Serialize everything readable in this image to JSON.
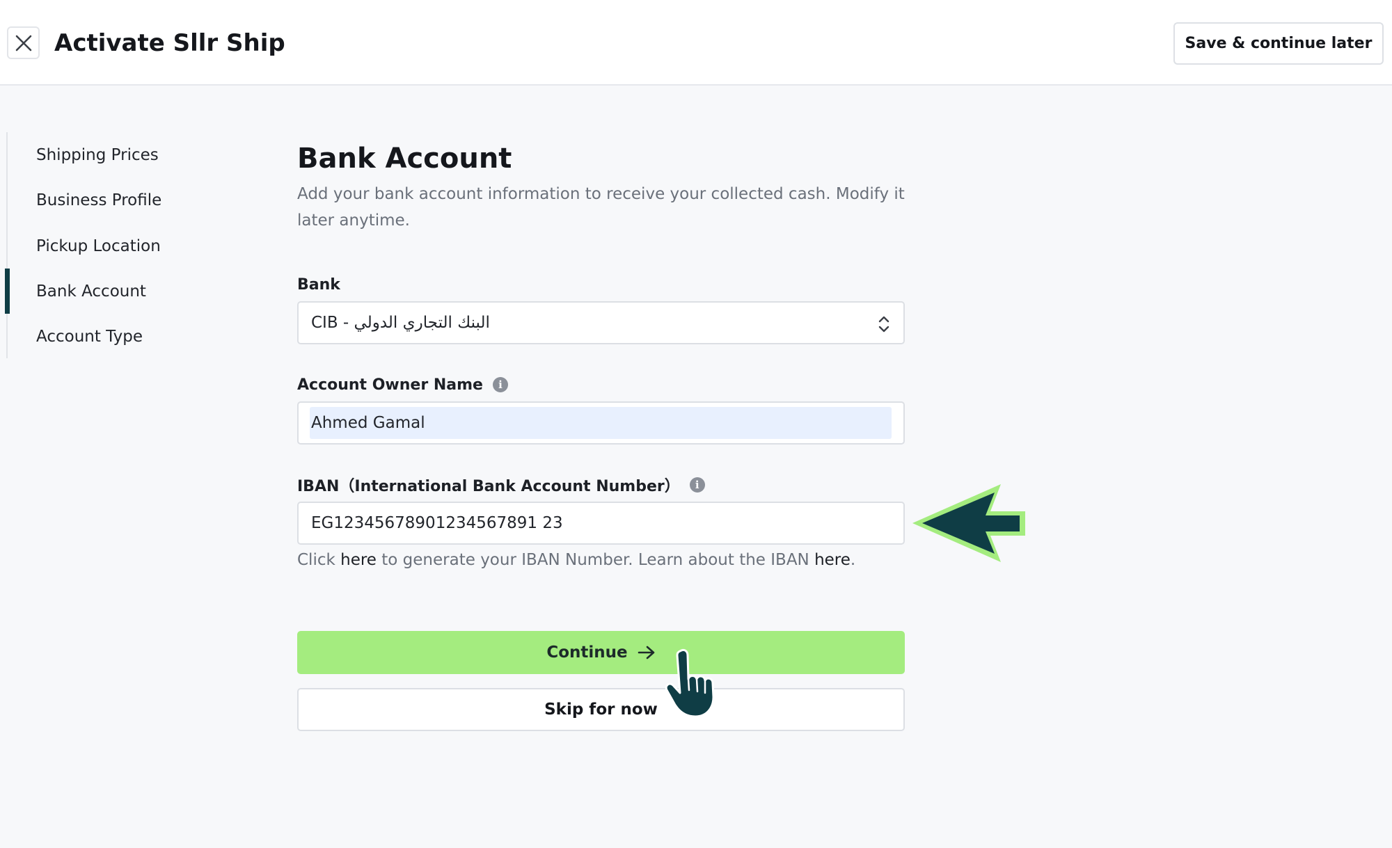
{
  "header": {
    "title": "Activate Sllr Ship",
    "save_later_label": "Save & continue later"
  },
  "sidebar": {
    "items": [
      {
        "label": "Shipping Prices",
        "active": false
      },
      {
        "label": "Business Profile",
        "active": false
      },
      {
        "label": "Pickup Location",
        "active": false
      },
      {
        "label": "Bank Account",
        "active": true
      },
      {
        "label": "Account Type",
        "active": false
      }
    ]
  },
  "form": {
    "title": "Bank Account",
    "description": "Add your bank account information to receive your collected cash. Modify it later anytime.",
    "bank": {
      "label": "Bank",
      "value": "CIB - البنك التجاري الدولي"
    },
    "owner": {
      "label": "Account Owner Name",
      "value": "Ahmed Gamal"
    },
    "iban": {
      "label": "IBAN（International Bank Account Number）",
      "value": "EG12345678901234567891 23"
    },
    "helper": {
      "prefix": "Click ",
      "link1": "here",
      "middle": " to generate your IBAN Number. Learn about the IBAN ",
      "link2": "here",
      "suffix": "."
    },
    "continue_label": "Continue",
    "skip_label": "Skip for now"
  },
  "icons": {
    "close": "close-icon",
    "info": "info-icon",
    "chevron": "select-chevron-icon",
    "arrow_right": "arrow-right-icon",
    "annotation_arrow": "annotation-arrow-icon",
    "hand": "hand-pointer-icon"
  },
  "colors": {
    "accent": "#a4ec7f",
    "active_indicator": "#0f3d45",
    "annotation_fill": "#0f3d45",
    "annotation_outline": "#a4ec7f"
  }
}
